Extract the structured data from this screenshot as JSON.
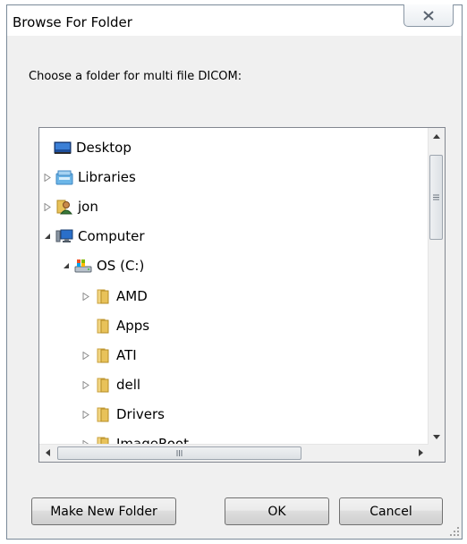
{
  "dialog": {
    "title": "Browse For Folder",
    "prompt": "Choose a folder for multi file DICOM:"
  },
  "tree": {
    "items": [
      {
        "label": "Desktop",
        "icon": "desktop-icon"
      },
      {
        "label": "Libraries",
        "icon": "libraries-icon",
        "expander": "collapsed"
      },
      {
        "label": "jon",
        "icon": "user-icon",
        "expander": "collapsed"
      },
      {
        "label": "Computer",
        "icon": "computer-icon",
        "expander": "expanded"
      },
      {
        "label": "OS (C:)",
        "icon": "drive-icon",
        "expander": "expanded"
      },
      {
        "label": "AMD",
        "icon": "folder-icon",
        "expander": "collapsed"
      },
      {
        "label": "Apps",
        "icon": "folder-icon"
      },
      {
        "label": "ATI",
        "icon": "folder-icon",
        "expander": "collapsed"
      },
      {
        "label": "dell",
        "icon": "folder-icon",
        "expander": "collapsed"
      },
      {
        "label": "Drivers",
        "icon": "folder-icon",
        "expander": "collapsed"
      },
      {
        "label": "ImageRoot",
        "icon": "folder-icon",
        "expander": "collapsed"
      }
    ]
  },
  "buttons": {
    "make_new_folder": "Make New Folder",
    "ok": "OK",
    "cancel": "Cancel"
  },
  "colors": {
    "folder": "#e8c25a",
    "selection_border": "#7da2ce",
    "dialog_bg": "#f0f0f0"
  }
}
